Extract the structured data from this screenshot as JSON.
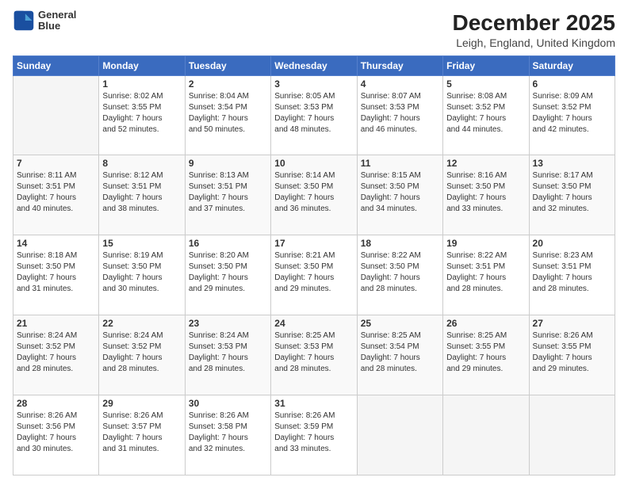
{
  "logo": {
    "line1": "General",
    "line2": "Blue"
  },
  "title": "December 2025",
  "subtitle": "Leigh, England, United Kingdom",
  "header_days": [
    "Sunday",
    "Monday",
    "Tuesday",
    "Wednesday",
    "Thursday",
    "Friday",
    "Saturday"
  ],
  "weeks": [
    [
      {
        "day": "",
        "info": ""
      },
      {
        "day": "1",
        "info": "Sunrise: 8:02 AM\nSunset: 3:55 PM\nDaylight: 7 hours\nand 52 minutes."
      },
      {
        "day": "2",
        "info": "Sunrise: 8:04 AM\nSunset: 3:54 PM\nDaylight: 7 hours\nand 50 minutes."
      },
      {
        "day": "3",
        "info": "Sunrise: 8:05 AM\nSunset: 3:53 PM\nDaylight: 7 hours\nand 48 minutes."
      },
      {
        "day": "4",
        "info": "Sunrise: 8:07 AM\nSunset: 3:53 PM\nDaylight: 7 hours\nand 46 minutes."
      },
      {
        "day": "5",
        "info": "Sunrise: 8:08 AM\nSunset: 3:52 PM\nDaylight: 7 hours\nand 44 minutes."
      },
      {
        "day": "6",
        "info": "Sunrise: 8:09 AM\nSunset: 3:52 PM\nDaylight: 7 hours\nand 42 minutes."
      }
    ],
    [
      {
        "day": "7",
        "info": "Sunrise: 8:11 AM\nSunset: 3:51 PM\nDaylight: 7 hours\nand 40 minutes."
      },
      {
        "day": "8",
        "info": "Sunrise: 8:12 AM\nSunset: 3:51 PM\nDaylight: 7 hours\nand 38 minutes."
      },
      {
        "day": "9",
        "info": "Sunrise: 8:13 AM\nSunset: 3:51 PM\nDaylight: 7 hours\nand 37 minutes."
      },
      {
        "day": "10",
        "info": "Sunrise: 8:14 AM\nSunset: 3:50 PM\nDaylight: 7 hours\nand 36 minutes."
      },
      {
        "day": "11",
        "info": "Sunrise: 8:15 AM\nSunset: 3:50 PM\nDaylight: 7 hours\nand 34 minutes."
      },
      {
        "day": "12",
        "info": "Sunrise: 8:16 AM\nSunset: 3:50 PM\nDaylight: 7 hours\nand 33 minutes."
      },
      {
        "day": "13",
        "info": "Sunrise: 8:17 AM\nSunset: 3:50 PM\nDaylight: 7 hours\nand 32 minutes."
      }
    ],
    [
      {
        "day": "14",
        "info": "Sunrise: 8:18 AM\nSunset: 3:50 PM\nDaylight: 7 hours\nand 31 minutes."
      },
      {
        "day": "15",
        "info": "Sunrise: 8:19 AM\nSunset: 3:50 PM\nDaylight: 7 hours\nand 30 minutes."
      },
      {
        "day": "16",
        "info": "Sunrise: 8:20 AM\nSunset: 3:50 PM\nDaylight: 7 hours\nand 29 minutes."
      },
      {
        "day": "17",
        "info": "Sunrise: 8:21 AM\nSunset: 3:50 PM\nDaylight: 7 hours\nand 29 minutes."
      },
      {
        "day": "18",
        "info": "Sunrise: 8:22 AM\nSunset: 3:50 PM\nDaylight: 7 hours\nand 28 minutes."
      },
      {
        "day": "19",
        "info": "Sunrise: 8:22 AM\nSunset: 3:51 PM\nDaylight: 7 hours\nand 28 minutes."
      },
      {
        "day": "20",
        "info": "Sunrise: 8:23 AM\nSunset: 3:51 PM\nDaylight: 7 hours\nand 28 minutes."
      }
    ],
    [
      {
        "day": "21",
        "info": "Sunrise: 8:24 AM\nSunset: 3:52 PM\nDaylight: 7 hours\nand 28 minutes."
      },
      {
        "day": "22",
        "info": "Sunrise: 8:24 AM\nSunset: 3:52 PM\nDaylight: 7 hours\nand 28 minutes."
      },
      {
        "day": "23",
        "info": "Sunrise: 8:24 AM\nSunset: 3:53 PM\nDaylight: 7 hours\nand 28 minutes."
      },
      {
        "day": "24",
        "info": "Sunrise: 8:25 AM\nSunset: 3:53 PM\nDaylight: 7 hours\nand 28 minutes."
      },
      {
        "day": "25",
        "info": "Sunrise: 8:25 AM\nSunset: 3:54 PM\nDaylight: 7 hours\nand 28 minutes."
      },
      {
        "day": "26",
        "info": "Sunrise: 8:25 AM\nSunset: 3:55 PM\nDaylight: 7 hours\nand 29 minutes."
      },
      {
        "day": "27",
        "info": "Sunrise: 8:26 AM\nSunset: 3:55 PM\nDaylight: 7 hours\nand 29 minutes."
      }
    ],
    [
      {
        "day": "28",
        "info": "Sunrise: 8:26 AM\nSunset: 3:56 PM\nDaylight: 7 hours\nand 30 minutes."
      },
      {
        "day": "29",
        "info": "Sunrise: 8:26 AM\nSunset: 3:57 PM\nDaylight: 7 hours\nand 31 minutes."
      },
      {
        "day": "30",
        "info": "Sunrise: 8:26 AM\nSunset: 3:58 PM\nDaylight: 7 hours\nand 32 minutes."
      },
      {
        "day": "31",
        "info": "Sunrise: 8:26 AM\nSunset: 3:59 PM\nDaylight: 7 hours\nand 33 minutes."
      },
      {
        "day": "",
        "info": ""
      },
      {
        "day": "",
        "info": ""
      },
      {
        "day": "",
        "info": ""
      }
    ]
  ]
}
